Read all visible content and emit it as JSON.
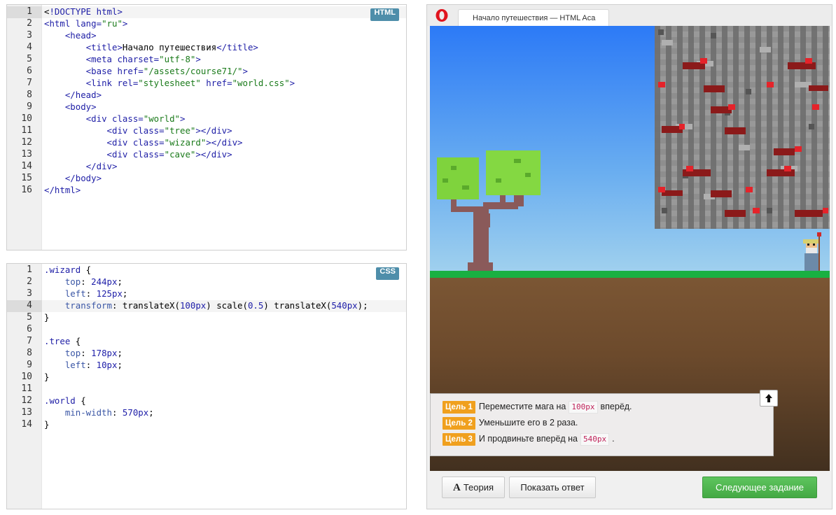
{
  "html_editor": {
    "badge": "HTML",
    "line_numbers": [
      "1",
      "2",
      "3",
      "4",
      "5",
      "6",
      "7",
      "8",
      "9",
      "10",
      "11",
      "12",
      "13",
      "14",
      "15",
      "16"
    ],
    "lines": [
      [
        [
          "bl",
          "<"
        ],
        [
          "tag",
          "!DOCTYPE html"
        ],
        [
          "tag",
          ">"
        ]
      ],
      [
        [
          "tag",
          "<html "
        ],
        [
          "attr",
          "lang="
        ],
        [
          "str",
          "\"ru\""
        ],
        [
          "tag",
          ">"
        ]
      ],
      [
        [
          "bl",
          "    "
        ],
        [
          "tag",
          "<head>"
        ]
      ],
      [
        [
          "bl",
          "        "
        ],
        [
          "tag",
          "<title>"
        ],
        [
          "bl",
          "Начало путешествия"
        ],
        [
          "tag",
          "</title>"
        ]
      ],
      [
        [
          "bl",
          "        "
        ],
        [
          "tag",
          "<meta "
        ],
        [
          "attr",
          "charset="
        ],
        [
          "str",
          "\"utf-8\""
        ],
        [
          "tag",
          ">"
        ]
      ],
      [
        [
          "bl",
          "        "
        ],
        [
          "tag",
          "<base "
        ],
        [
          "attr",
          "href="
        ],
        [
          "str",
          "\"/assets/course71/\""
        ],
        [
          "tag",
          ">"
        ]
      ],
      [
        [
          "bl",
          "        "
        ],
        [
          "tag",
          "<link "
        ],
        [
          "attr",
          "rel="
        ],
        [
          "str",
          "\"stylesheet\""
        ],
        [
          "attr",
          " href="
        ],
        [
          "str",
          "\"world.css\""
        ],
        [
          "tag",
          ">"
        ]
      ],
      [
        [
          "bl",
          "    "
        ],
        [
          "tag",
          "</head>"
        ]
      ],
      [
        [
          "bl",
          "    "
        ],
        [
          "tag",
          "<body>"
        ]
      ],
      [
        [
          "bl",
          "        "
        ],
        [
          "tag",
          "<div "
        ],
        [
          "attr",
          "class="
        ],
        [
          "str",
          "\"world\""
        ],
        [
          "tag",
          ">"
        ]
      ],
      [
        [
          "bl",
          "            "
        ],
        [
          "tag",
          "<div "
        ],
        [
          "attr",
          "class="
        ],
        [
          "str",
          "\"tree\""
        ],
        [
          "tag",
          "></div>"
        ]
      ],
      [
        [
          "bl",
          "            "
        ],
        [
          "tag",
          "<div "
        ],
        [
          "attr",
          "class="
        ],
        [
          "str",
          "\"wizard\""
        ],
        [
          "tag",
          "></div>"
        ]
      ],
      [
        [
          "bl",
          "            "
        ],
        [
          "tag",
          "<div "
        ],
        [
          "attr",
          "class="
        ],
        [
          "str",
          "\"cave\""
        ],
        [
          "tag",
          "></div>"
        ]
      ],
      [
        [
          "bl",
          "        "
        ],
        [
          "tag",
          "</div>"
        ]
      ],
      [
        [
          "bl",
          "    "
        ],
        [
          "tag",
          "</body>"
        ]
      ],
      [
        [
          "tag",
          "</html>"
        ]
      ]
    ]
  },
  "css_editor": {
    "badge": "CSS",
    "line_numbers": [
      "1",
      "2",
      "3",
      "4",
      "5",
      "6",
      "7",
      "8",
      "9",
      "10",
      "11",
      "12",
      "13",
      "14"
    ],
    "lines": [
      [
        [
          "sel",
          ".wizard"
        ],
        [
          "bl",
          " {"
        ]
      ],
      [
        [
          "bl",
          "    "
        ],
        [
          "prop",
          "top"
        ],
        [
          "bl",
          ": "
        ],
        [
          "num",
          "244px"
        ],
        [
          "bl",
          ";"
        ]
      ],
      [
        [
          "bl",
          "    "
        ],
        [
          "prop",
          "left"
        ],
        [
          "bl",
          ": "
        ],
        [
          "num",
          "125px"
        ],
        [
          "bl",
          ";"
        ]
      ],
      [
        [
          "bl",
          "    "
        ],
        [
          "prop",
          "transform"
        ],
        [
          "bl",
          ": translateX("
        ],
        [
          "num",
          "100px"
        ],
        [
          "bl",
          ") scale("
        ],
        [
          "num",
          "0.5"
        ],
        [
          "bl",
          ") translateX("
        ],
        [
          "num",
          "540px"
        ],
        [
          "bl",
          ");"
        ]
      ],
      [
        [
          "bl",
          "}"
        ]
      ],
      [
        [
          "bl",
          ""
        ]
      ],
      [
        [
          "sel",
          ".tree"
        ],
        [
          "bl",
          " {"
        ]
      ],
      [
        [
          "bl",
          "    "
        ],
        [
          "prop",
          "top"
        ],
        [
          "bl",
          ": "
        ],
        [
          "num",
          "178px"
        ],
        [
          "bl",
          ";"
        ]
      ],
      [
        [
          "bl",
          "    "
        ],
        [
          "prop",
          "left"
        ],
        [
          "bl",
          ": "
        ],
        [
          "num",
          "10px"
        ],
        [
          "bl",
          ";"
        ]
      ],
      [
        [
          "bl",
          "}"
        ]
      ],
      [
        [
          "bl",
          ""
        ]
      ],
      [
        [
          "sel",
          ".world"
        ],
        [
          "bl",
          " {"
        ]
      ],
      [
        [
          "bl",
          "    "
        ],
        [
          "prop",
          "min-width"
        ],
        [
          "bl",
          ": "
        ],
        [
          "num",
          "570px"
        ],
        [
          "bl",
          ";"
        ]
      ],
      [
        [
          "bl",
          "}"
        ]
      ]
    ]
  },
  "browser": {
    "tab_title": "Начало путешествия — HTML Aca",
    "goals": [
      {
        "badge": "Цель 1",
        "before": "Переместите мага на",
        "code": "100px",
        "after": "вперёд."
      },
      {
        "badge": "Цель 2",
        "before": "Уменьшите его в 2 раза.",
        "code": "",
        "after": ""
      },
      {
        "badge": "Цель 3",
        "before": "И продвиньте вперёд на",
        "code": "540px",
        "after": "."
      }
    ],
    "theory_label": "Теория",
    "theory_icon": "А",
    "show_answer_label": "Показать ответ",
    "next_label": "Следующее задание"
  },
  "colors": {
    "grass": "#19b042",
    "sky": "#2c7af6",
    "next_button": "#4cb34c",
    "goal_badge": "#f0a01e",
    "editor_badge": "#4e8eaa"
  },
  "icons": [
    "opera-icon",
    "arrow-up-icon",
    "theory-icon"
  ]
}
